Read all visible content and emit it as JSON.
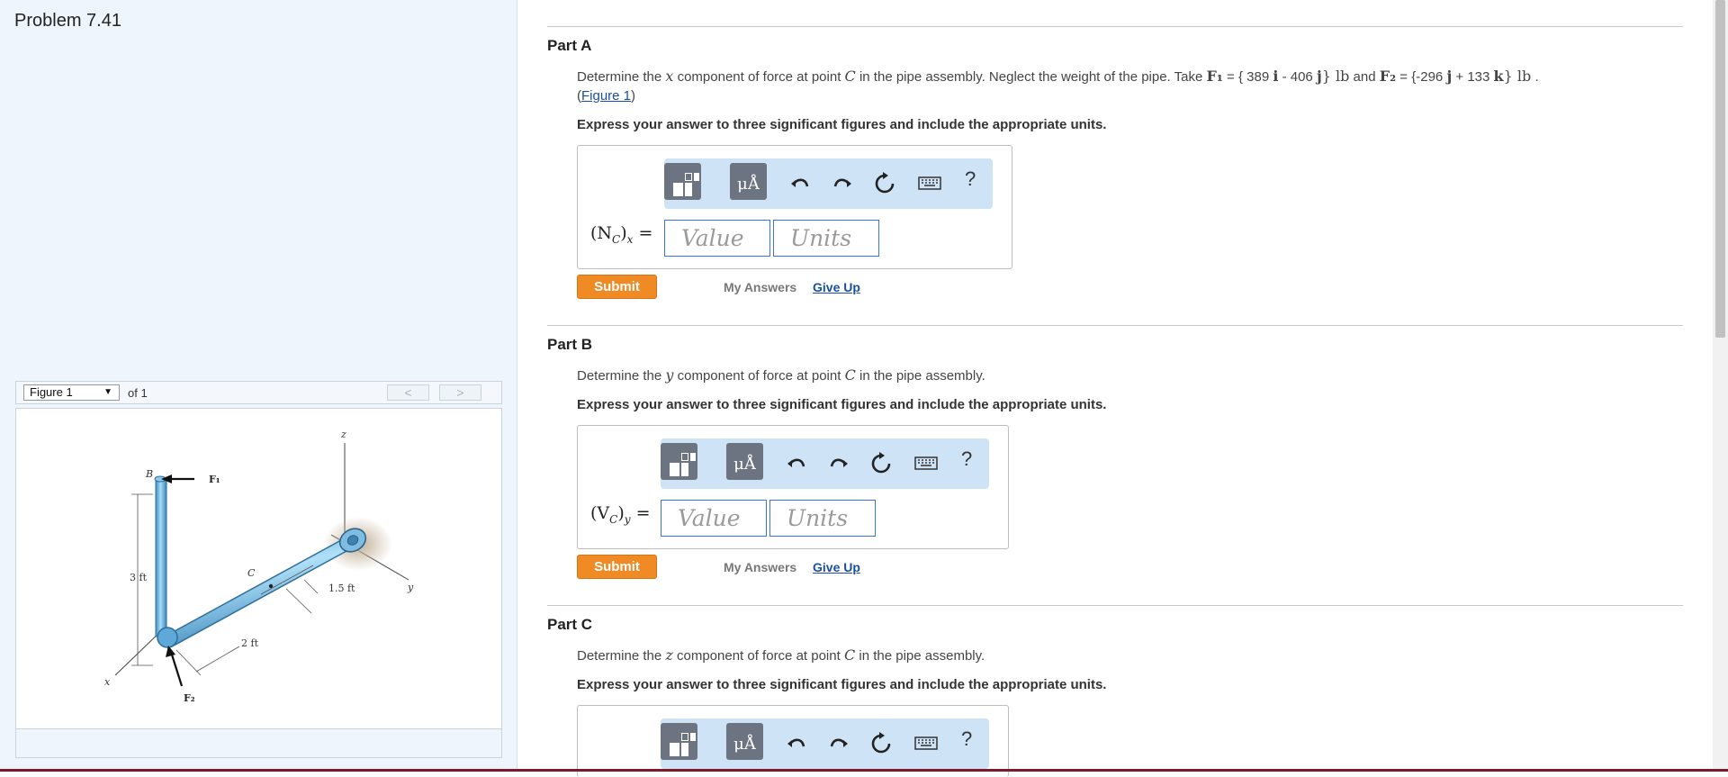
{
  "problem": {
    "title": "Problem 7.41"
  },
  "figure_panel": {
    "selected": "Figure 1",
    "of_label": "of 1",
    "prev": "<",
    "next": ">",
    "labels": {
      "z": "z",
      "y": "y",
      "x": "x",
      "B": "B",
      "C": "C",
      "F1": "F₁",
      "F2": "F₂",
      "d3ft": "3 ft",
      "d2ft": "2 ft",
      "d15ft": "1.5 ft"
    }
  },
  "parts": [
    {
      "title": "Part A",
      "q_pre": "Determine the ",
      "q_var": "x",
      "q_mid": " component of force at point ",
      "q_pt": "C",
      "q_post": " in the pipe assembly. Neglect the weight of the pipe. Take ",
      "f1_sym": "F₁",
      "f1_open": " = { ",
      "f1_i": "389 ",
      "i_unit": "i",
      "f1_j": " - 406 ",
      "j_unit": "j",
      "f1_close": "}",
      "lb1": " lb",
      "and": " and ",
      "f2_sym": "F₂",
      "f2_open": " = {",
      "f2_j": "-296 ",
      "j2_unit": "j",
      "f2_k": " + 133 ",
      "k_unit": "k",
      "f2_close": "}",
      "lb2": " lb",
      "dot": " .",
      "link_open": "(",
      "link": "Figure 1",
      "link_close": ")",
      "instruction": "Express your answer to three significant figures and include the appropriate units.",
      "label_main": "(N",
      "label_sub1": "C",
      "label_close": ")",
      "label_sub2": "x",
      "label_eq": " =",
      "value_placeholder": "Value",
      "units_placeholder": "Units",
      "submit": "Submit",
      "my_answers": "My Answers",
      "give_up": "Give Up"
    },
    {
      "title": "Part B",
      "q_pre": "Determine the ",
      "q_var": "y",
      "q_mid": " component of force at point ",
      "q_pt": "C",
      "q_post": " in the pipe assembly.",
      "instruction": "Express your answer to three significant figures and include the appropriate units.",
      "label_main": "(V",
      "label_sub1": "C",
      "label_close": ")",
      "label_sub2": "y",
      "label_eq": " =",
      "value_placeholder": "Value",
      "units_placeholder": "Units",
      "submit": "Submit",
      "my_answers": "My Answers",
      "give_up": "Give Up"
    },
    {
      "title": "Part C",
      "q_pre": "Determine the ",
      "q_var": "z",
      "q_mid": " component of force at point ",
      "q_pt": "C",
      "q_post": " in the pipe assembly.",
      "instruction": "Express your answer to three significant figures and include the appropriate units."
    }
  ],
  "toolbar": {
    "units_label": "μÅ",
    "help": "?"
  },
  "icons": [
    "templates-icon",
    "units-icon",
    "undo-icon",
    "redo-icon",
    "reset-icon",
    "keyboard-icon",
    "help-icon"
  ]
}
